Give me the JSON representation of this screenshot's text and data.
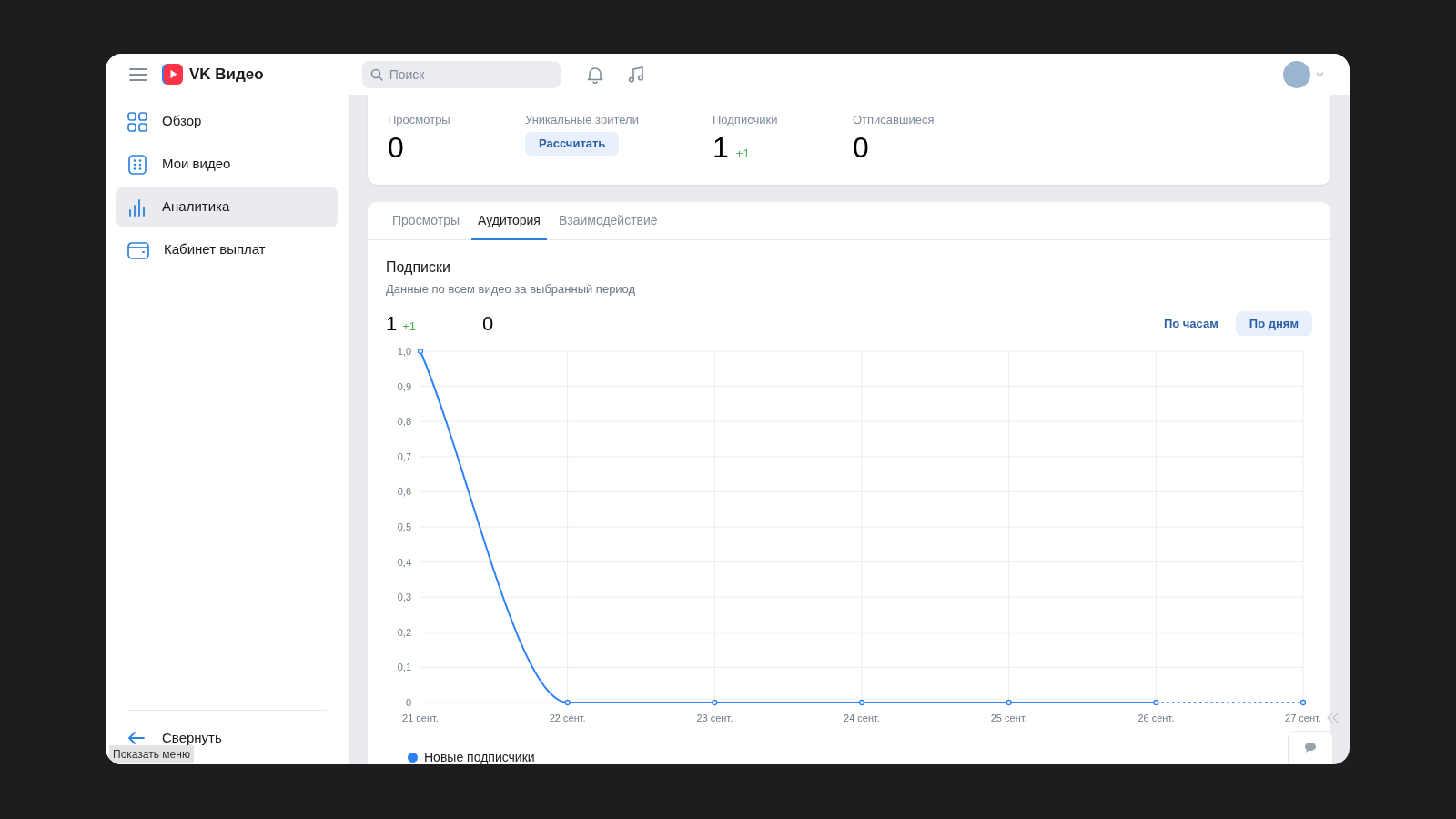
{
  "header": {
    "app_name": "VK Видео",
    "search": {
      "placeholder": "Поиск"
    }
  },
  "sidebar": {
    "items": [
      {
        "label": "Обзор",
        "selected": false
      },
      {
        "label": "Мои видео",
        "selected": false
      },
      {
        "label": "Аналитика",
        "selected": true
      },
      {
        "label": "Кабинет выплат",
        "selected": false
      }
    ],
    "collapse": "Свернуть"
  },
  "tooltip": "Показать меню",
  "stats": [
    {
      "kind": "value",
      "label": "Просмотры",
      "value": "0"
    },
    {
      "kind": "button",
      "label": "Уникальные зрители",
      "button": "Рассчитать"
    },
    {
      "kind": "value",
      "label": "Подписчики",
      "value": "1",
      "delta": "+1"
    },
    {
      "kind": "value",
      "label": "Отписавшиеся",
      "value": "0"
    }
  ],
  "tabs": [
    {
      "label": "Просмотры",
      "selected": false
    },
    {
      "label": "Аудитория",
      "selected": true
    },
    {
      "label": "Взаимодействие",
      "selected": false
    }
  ],
  "panel": {
    "title": "Подписки",
    "subtitle": "Данные по всем видео за выбранный период",
    "summary": [
      {
        "value": "1",
        "delta": "+1"
      },
      {
        "value": "0"
      }
    ],
    "granularity": [
      {
        "label": "По часам",
        "selected": false
      },
      {
        "label": "По дням",
        "selected": true
      }
    ],
    "chart_data": {
      "type": "line",
      "categories": [
        "21 сент.",
        "22 сент.",
        "23 сент.",
        "24 сент.",
        "25 сент.",
        "26 сент.",
        "27 сент."
      ],
      "series": [
        {
          "name": "Новые подписчики",
          "color": "#2d81f7",
          "marker": true,
          "values": [
            1,
            0,
            0,
            0,
            0,
            0,
            0
          ]
        }
      ],
      "ylim": [
        0,
        1
      ],
      "grid": true,
      "yticks": [
        {
          "value": 0,
          "label": "0"
        },
        {
          "value": 0.1,
          "label": "0,1"
        },
        {
          "value": 0.2,
          "label": "0,2"
        },
        {
          "value": 0.3,
          "label": "0,3"
        },
        {
          "value": 0.4,
          "label": "0,4"
        },
        {
          "value": 0.5,
          "label": "0,5"
        },
        {
          "value": 0.6,
          "label": "0,6"
        },
        {
          "value": 0.7,
          "label": "0,7"
        },
        {
          "value": 0.8,
          "label": "0,8"
        },
        {
          "value": 0.9,
          "label": "0,9"
        },
        {
          "value": 1,
          "label": "1,0"
        }
      ]
    }
  }
}
